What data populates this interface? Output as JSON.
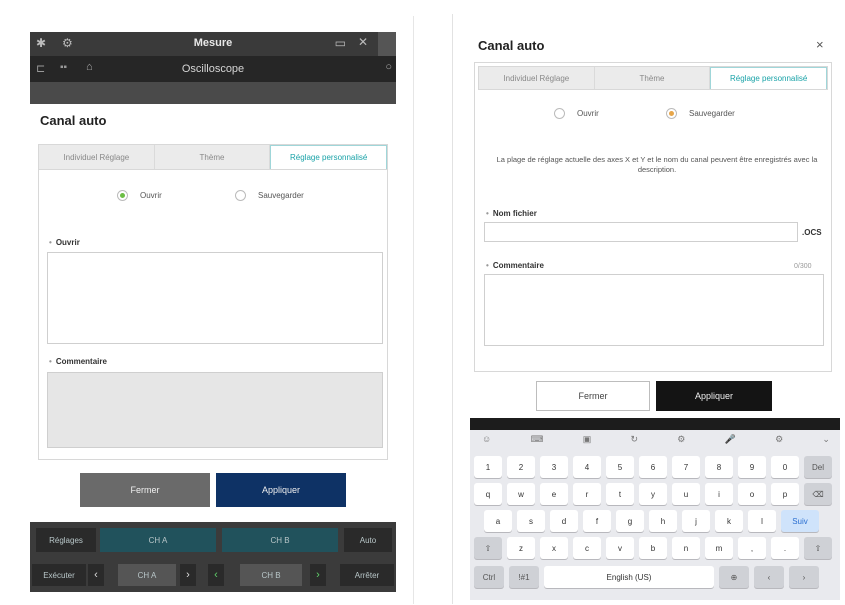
{
  "left": {
    "statusbar": {
      "title": "Mesure",
      "icons": [
        "bluetooth-icon",
        "settings-icon",
        "battery-icon",
        "close-icon"
      ]
    },
    "appbar": {
      "title": "Oscilloscope",
      "icons": [
        "back-icon",
        "layout-icon",
        "search-icon"
      ]
    },
    "dialog": {
      "title": "Canal auto",
      "tabs": [
        "Individuel Réglage",
        "Thème",
        "Réglage personnalisé"
      ],
      "active_tab": 2,
      "radios": [
        {
          "label": "Ouvrir",
          "checked": true
        },
        {
          "label": "Sauvegarder",
          "checked": false
        }
      ],
      "field1_label": "Ouvrir",
      "field2_label": "Commentaire",
      "buttons": {
        "close": "Fermer",
        "apply": "Appliquer"
      }
    },
    "bottombar": {
      "row1": [
        "Réglages",
        "CH A",
        "CH B",
        "Auto"
      ],
      "row2": [
        "Exécuter",
        "‹",
        "CH A",
        "›",
        "‹",
        "CH B",
        "›",
        "Arrêter"
      ]
    }
  },
  "right": {
    "dialog": {
      "title": "Canal auto",
      "close_icon": "×",
      "tabs": [
        "Individuel Réglage",
        "Thème",
        "Réglage personnalisé"
      ],
      "active_tab": 2,
      "radios": [
        {
          "label": "Ouvrir",
          "checked": false
        },
        {
          "label": "Sauvegarder",
          "checked": true
        }
      ],
      "description": "La plage de réglage actuelle des axes X et Y et le nom du canal peuvent être enregistrés avec la description.",
      "filename_label": "Nom fichier",
      "filename_value": "",
      "filename_ext": ".OCS",
      "comment_label": "Commentaire",
      "comment_counter": "0/300",
      "buttons": {
        "close": "Fermer",
        "apply": "Appliquer"
      }
    },
    "keyboard": {
      "toolbar": [
        "☺",
        "⌨",
        "▣",
        "↻",
        "⚙",
        "🎤",
        "⚙",
        "⌄"
      ],
      "row1": [
        "1",
        "2",
        "3",
        "4",
        "5",
        "6",
        "7",
        "8",
        "9",
        "0",
        "Del"
      ],
      "row2": [
        "q",
        "w",
        "e",
        "r",
        "t",
        "y",
        "u",
        "i",
        "o",
        "p",
        "⌫"
      ],
      "row3": [
        "a",
        "s",
        "d",
        "f",
        "g",
        "h",
        "j",
        "k",
        "l",
        "Suiv"
      ],
      "row4": [
        "⇧",
        "z",
        "x",
        "c",
        "v",
        "b",
        "n",
        "m",
        ",",
        ".",
        "⇧"
      ],
      "row5": [
        "Ctrl",
        "!#1",
        "English (US)",
        "⊕",
        "‹",
        "›"
      ]
    }
  }
}
